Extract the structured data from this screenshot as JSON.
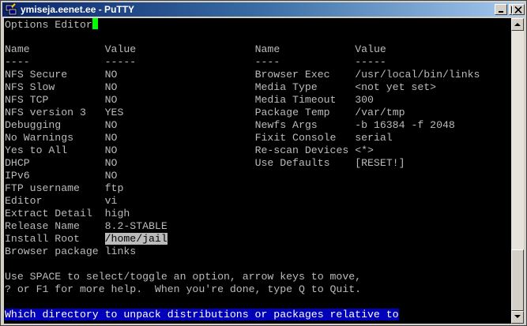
{
  "window": {
    "title": "ymiseja.eenet.ee - PuTTY",
    "icon": "putty-icon",
    "controls": {
      "minimize": "minimize-icon",
      "maximize": "maximize-icon",
      "close": "close-icon"
    }
  },
  "terminal": {
    "header": "Options Editor",
    "columns": {
      "name": "Name",
      "value": "Value",
      "rule_name": "----",
      "rule_value": "-----"
    },
    "left_options": [
      {
        "name": "NFS Secure",
        "value": "NO"
      },
      {
        "name": "NFS Slow",
        "value": "NO"
      },
      {
        "name": "NFS TCP",
        "value": "NO"
      },
      {
        "name": "NFS version 3",
        "value": "YES"
      },
      {
        "name": "Debugging",
        "value": "NO"
      },
      {
        "name": "No Warnings",
        "value": "NO"
      },
      {
        "name": "Yes to All",
        "value": "NO"
      },
      {
        "name": "DHCP",
        "value": "NO"
      },
      {
        "name": "IPv6",
        "value": "NO"
      },
      {
        "name": "FTP username",
        "value": "ftp"
      },
      {
        "name": "Editor",
        "value": "vi"
      },
      {
        "name": "Extract Detail",
        "value": "high"
      },
      {
        "name": "Release Name",
        "value": "8.2-STABLE"
      },
      {
        "name": "Install Root",
        "value": "/home/jail"
      },
      {
        "name": "Browser package",
        "value": "links"
      }
    ],
    "right_options": [
      {
        "name": "Browser Exec",
        "value": "/usr/local/bin/links"
      },
      {
        "name": "Media Type",
        "value": "<not yet set>"
      },
      {
        "name": "Media Timeout",
        "value": "300"
      },
      {
        "name": "Package Temp",
        "value": "/var/tmp"
      },
      {
        "name": "Newfs Args",
        "value": "-b 16384 -f 2048"
      },
      {
        "name": "Fixit Console",
        "value": "serial"
      },
      {
        "name": "Re-scan Devices",
        "value": "<*>"
      },
      {
        "name": "Use Defaults",
        "value": "[RESET!]"
      }
    ],
    "selected_left_index": 13,
    "help_lines": [
      "Use SPACE to select/toggle an option, arrow keys to move,",
      "? or F1 for more help.  When you're done, type Q to Quit."
    ],
    "status_line": "Which directory to unpack distributions or packages relative to",
    "colors": {
      "background": "#000000",
      "text": "#bbbbbb",
      "cursor": "#00ff00",
      "status_bg": "#0000bb",
      "status_fg": "#ffffff"
    }
  },
  "scrollbar": {
    "up_icon": "scroll-up-arrow-icon",
    "down_icon": "scroll-down-arrow-icon",
    "position": "bottom"
  }
}
